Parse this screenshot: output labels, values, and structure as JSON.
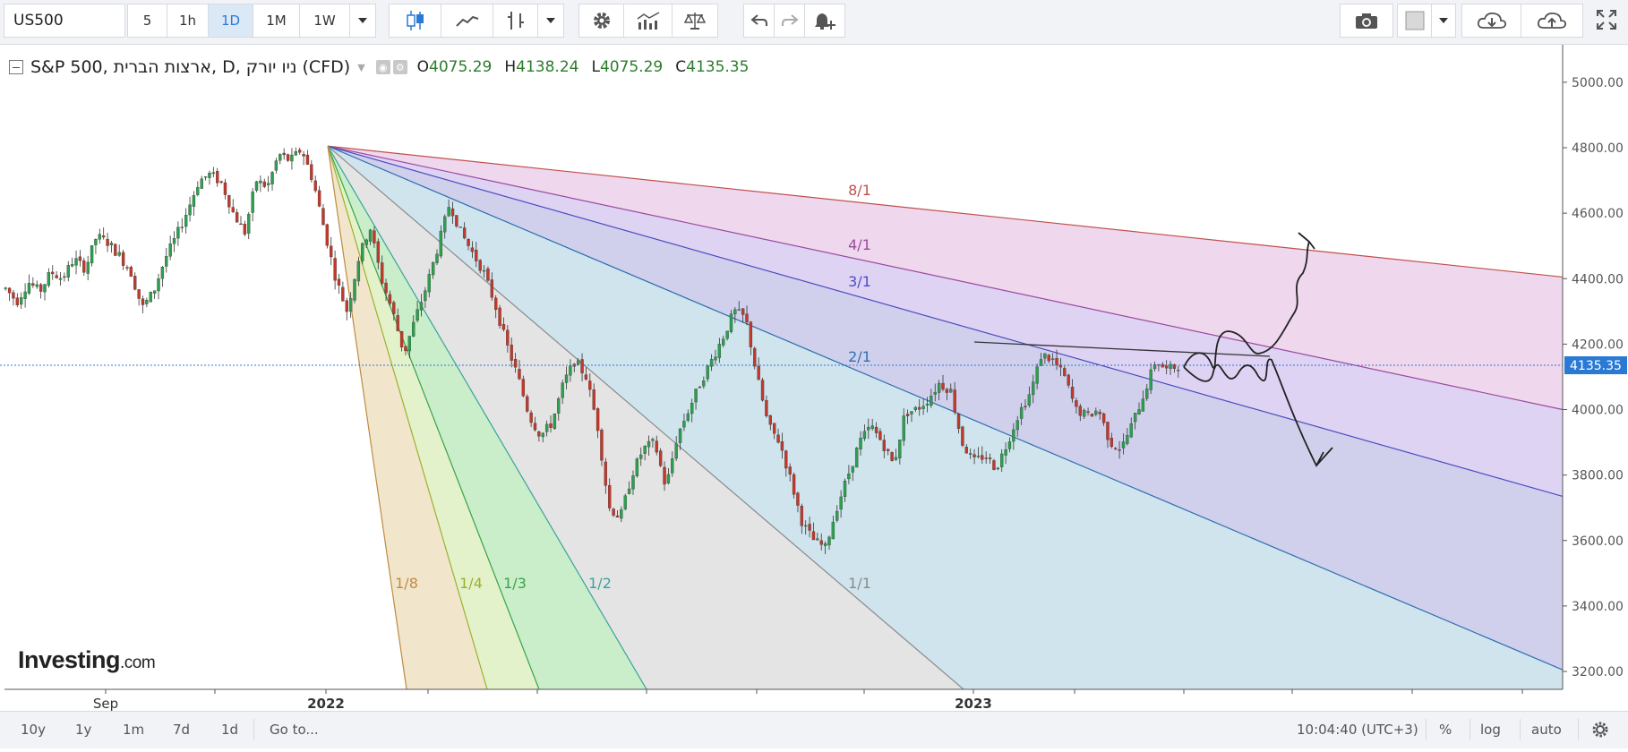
{
  "toolbar": {
    "symbol": "US500",
    "intervals": [
      "5",
      "1h",
      "1D",
      "1M",
      "1W"
    ],
    "active_interval": "1D"
  },
  "legend": {
    "title": "S&P 500, ארצות הברית, D, ניו יורק (CFD)",
    "o_label": "O",
    "o_value": "4075.29",
    "h_label": "H",
    "h_value": "4138.24",
    "l_label": "L",
    "l_value": "4075.29",
    "c_label": "C",
    "c_value": "4135.35"
  },
  "logo": {
    "main": "Investing",
    "suffix": ".com"
  },
  "chart_data": {
    "type": "candlestick",
    "y_ticks": [
      "5000.00",
      "4800.00",
      "4600.00",
      "4400.00",
      "4200.00",
      "4000.00",
      "3800.00",
      "3600.00",
      "3400.00",
      "3200.00"
    ],
    "y_tick_values": [
      5000,
      4800,
      4600,
      4400,
      4200,
      4000,
      3800,
      3600,
      3400,
      3200
    ],
    "ylim": [
      3150,
      5080
    ],
    "x_labels": [
      "Sep",
      "2022",
      "2023"
    ],
    "current_price": 4135.35,
    "current_price_label": "4135.35",
    "gann_fan_labels": [
      "8/1",
      "4/1",
      "3/1",
      "2/1",
      "1/1",
      "1/2",
      "1/3",
      "1/4",
      "1/8"
    ],
    "colors": {
      "up": "#2e9e4f",
      "down": "#c0392b",
      "price_line": "#2a7ad5"
    },
    "price_path": [
      4370,
      4330,
      4390,
      4360,
      4420,
      4400,
      4460,
      4430,
      4530,
      4510,
      4470,
      4420,
      4310,
      4360,
      4460,
      4530,
      4610,
      4700,
      4720,
      4690,
      4600,
      4540,
      4700,
      4680,
      4780,
      4760,
      4796,
      4700,
      4550,
      4400,
      4300,
      4460,
      4560,
      4400,
      4300,
      4170,
      4280,
      4380,
      4500,
      4631,
      4540,
      4480,
      4420,
      4320,
      4200,
      4100,
      3980,
      3920,
      3960,
      4080,
      4150,
      4100,
      3950,
      3700,
      3670,
      3800,
      3880,
      3900,
      3760,
      3920,
      4000,
      4080,
      4150,
      4220,
      4300,
      4280,
      4100,
      3950,
      3900,
      3780,
      3650,
      3600,
      3577,
      3700,
      3800,
      3900,
      3950,
      3900,
      3830,
      3990,
      4000,
      4030,
      4080,
      4060,
      3900,
      3840,
      3860,
      3820,
      3900,
      3990,
      4050,
      4170,
      4150,
      4100,
      4000,
      3980,
      4000,
      3900,
      3880,
      3960,
      4050,
      4150,
      4120,
      4135
    ]
  },
  "bottombar": {
    "ranges": [
      "10y",
      "1y",
      "1m",
      "7d",
      "1d"
    ],
    "goto": "Go to...",
    "time": "10:04:40 (UTC+3)",
    "percent": "%",
    "log": "log",
    "auto": "auto"
  }
}
